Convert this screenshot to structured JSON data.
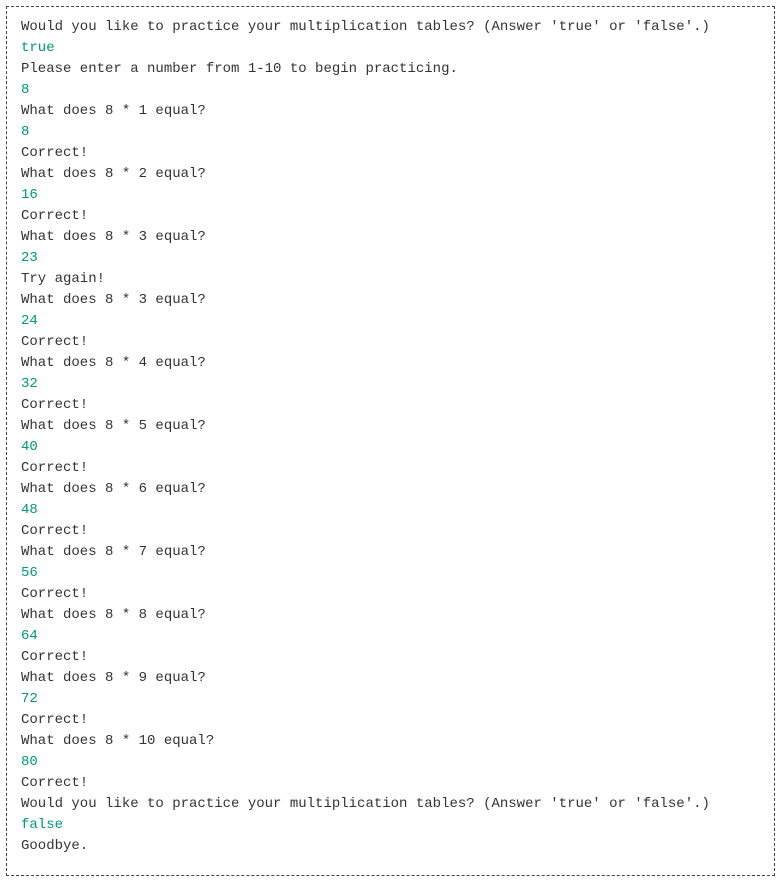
{
  "lines": [
    {
      "text": "Would you like to practice your multiplication tables? (Answer 'true' or 'false'.)",
      "type": "output"
    },
    {
      "text": "true",
      "type": "input"
    },
    {
      "text": "Please enter a number from 1-10 to begin practicing.",
      "type": "output"
    },
    {
      "text": "8",
      "type": "input"
    },
    {
      "text": "What does 8 * 1 equal?",
      "type": "output"
    },
    {
      "text": "8",
      "type": "input"
    },
    {
      "text": "Correct!",
      "type": "output"
    },
    {
      "text": "What does 8 * 2 equal?",
      "type": "output"
    },
    {
      "text": "16",
      "type": "input"
    },
    {
      "text": "Correct!",
      "type": "output"
    },
    {
      "text": "What does 8 * 3 equal?",
      "type": "output"
    },
    {
      "text": "23",
      "type": "input"
    },
    {
      "text": "Try again!",
      "type": "output"
    },
    {
      "text": "What does 8 * 3 equal?",
      "type": "output"
    },
    {
      "text": "24",
      "type": "input"
    },
    {
      "text": "Correct!",
      "type": "output"
    },
    {
      "text": "What does 8 * 4 equal?",
      "type": "output"
    },
    {
      "text": "32",
      "type": "input"
    },
    {
      "text": "Correct!",
      "type": "output"
    },
    {
      "text": "What does 8 * 5 equal?",
      "type": "output"
    },
    {
      "text": "40",
      "type": "input"
    },
    {
      "text": "Correct!",
      "type": "output"
    },
    {
      "text": "What does 8 * 6 equal?",
      "type": "output"
    },
    {
      "text": "48",
      "type": "input"
    },
    {
      "text": "Correct!",
      "type": "output"
    },
    {
      "text": "What does 8 * 7 equal?",
      "type": "output"
    },
    {
      "text": "56",
      "type": "input"
    },
    {
      "text": "Correct!",
      "type": "output"
    },
    {
      "text": "What does 8 * 8 equal?",
      "type": "output"
    },
    {
      "text": "64",
      "type": "input"
    },
    {
      "text": "Correct!",
      "type": "output"
    },
    {
      "text": "What does 8 * 9 equal?",
      "type": "output"
    },
    {
      "text": "72",
      "type": "input"
    },
    {
      "text": "Correct!",
      "type": "output"
    },
    {
      "text": "What does 8 * 10 equal?",
      "type": "output"
    },
    {
      "text": "80",
      "type": "input"
    },
    {
      "text": "Correct!",
      "type": "output"
    },
    {
      "text": "Would you like to practice your multiplication tables? (Answer 'true' or 'false'.)",
      "type": "output"
    },
    {
      "text": "false",
      "type": "input"
    },
    {
      "text": "Goodbye.",
      "type": "output"
    }
  ]
}
